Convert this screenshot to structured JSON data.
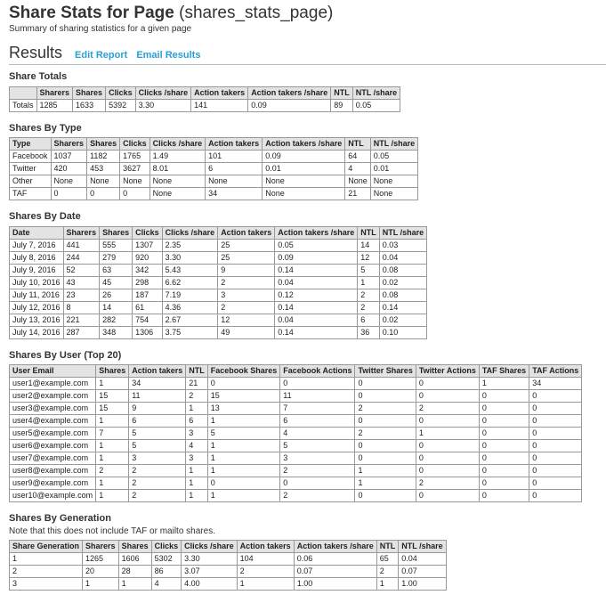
{
  "header": {
    "title": "Share Stats for Page",
    "slug": "(shares_stats_page)",
    "subtitle": "Summary of sharing statistics for a given page"
  },
  "results": {
    "title": "Results",
    "edit_report_label": "Edit Report",
    "email_results_label": "Email Results"
  },
  "tables": [
    {
      "title": "Share Totals",
      "headers": [
        "",
        "Sharers",
        "Shares",
        "Clicks",
        "Clicks /share",
        "Action takers",
        "Action takers /share",
        "NTL",
        "NTL /share"
      ],
      "rows": [
        [
          "Totals",
          "1285",
          "1633",
          "5392",
          "3.30",
          "141",
          "0.09",
          "89",
          "0.05"
        ]
      ]
    },
    {
      "title": "Shares By Type",
      "headers": [
        "Type",
        "Sharers",
        "Shares",
        "Clicks",
        "Clicks /share",
        "Action takers",
        "Action takers /share",
        "NTL",
        "NTL /share"
      ],
      "rows": [
        [
          "Facebook",
          "1037",
          "1182",
          "1765",
          "1.49",
          "101",
          "0.09",
          "64",
          "0.05"
        ],
        [
          "Twitter",
          "420",
          "453",
          "3627",
          "8.01",
          "6",
          "0.01",
          "4",
          "0.01"
        ],
        [
          "Other",
          "None",
          "None",
          "None",
          "None",
          "None",
          "None",
          "None",
          "None"
        ],
        [
          "TAF",
          "0",
          "0",
          "0",
          "None",
          "34",
          "None",
          "21",
          "None"
        ]
      ]
    },
    {
      "title": "Shares By Date",
      "headers": [
        "Date",
        "Sharers",
        "Shares",
        "Clicks",
        "Clicks /share",
        "Action takers",
        "Action takers /share",
        "NTL",
        "NTL /share"
      ],
      "rows": [
        [
          "July 7, 2016",
          "441",
          "555",
          "1307",
          "2.35",
          "25",
          "0.05",
          "14",
          "0.03"
        ],
        [
          "July 8, 2016",
          "244",
          "279",
          "920",
          "3.30",
          "25",
          "0.09",
          "12",
          "0.04"
        ],
        [
          "July 9, 2016",
          "52",
          "63",
          "342",
          "5.43",
          "9",
          "0.14",
          "5",
          "0.08"
        ],
        [
          "July 10, 2016",
          "43",
          "45",
          "298",
          "6.62",
          "2",
          "0.04",
          "1",
          "0.02"
        ],
        [
          "July 11, 2016",
          "23",
          "26",
          "187",
          "7.19",
          "3",
          "0.12",
          "2",
          "0.08"
        ],
        [
          "July 12, 2016",
          "8",
          "14",
          "61",
          "4.36",
          "2",
          "0.14",
          "2",
          "0.14"
        ],
        [
          "July 13, 2016",
          "221",
          "282",
          "754",
          "2.67",
          "12",
          "0.04",
          "6",
          "0.02"
        ],
        [
          "July 14, 2016",
          "287",
          "348",
          "1306",
          "3.75",
          "49",
          "0.14",
          "36",
          "0.10"
        ]
      ]
    },
    {
      "title": "Shares By User (Top 20)",
      "headers": [
        "User Email",
        "Shares",
        "Action takers",
        "NTL",
        "Facebook Shares",
        "Facebook Actions",
        "Twitter Shares",
        "Twitter Actions",
        "TAF Shares",
        "TAF Actions"
      ],
      "rows": [
        [
          "user1@example.com",
          "1",
          "34",
          "21",
          "0",
          "0",
          "0",
          "0",
          "1",
          "34"
        ],
        [
          "user2@example.com",
          "15",
          "11",
          "2",
          "15",
          "11",
          "0",
          "0",
          "0",
          "0"
        ],
        [
          "user3@example.com",
          "15",
          "9",
          "1",
          "13",
          "7",
          "2",
          "2",
          "0",
          "0"
        ],
        [
          "user4@example.com",
          "1",
          "6",
          "6",
          "1",
          "6",
          "0",
          "0",
          "0",
          "0"
        ],
        [
          "user5@example.com",
          "7",
          "5",
          "3",
          "5",
          "4",
          "2",
          "1",
          "0",
          "0"
        ],
        [
          "user6@example.com",
          "1",
          "5",
          "4",
          "1",
          "5",
          "0",
          "0",
          "0",
          "0"
        ],
        [
          "user7@example.com",
          "1",
          "3",
          "3",
          "1",
          "3",
          "0",
          "0",
          "0",
          "0"
        ],
        [
          "user8@example.com",
          "2",
          "2",
          "1",
          "1",
          "2",
          "1",
          "0",
          "0",
          "0"
        ],
        [
          "user9@example.com",
          "1",
          "2",
          "1",
          "0",
          "0",
          "1",
          "2",
          "0",
          "0"
        ],
        [
          "user10@example.com",
          "1",
          "2",
          "1",
          "1",
          "2",
          "0",
          "0",
          "0",
          "0"
        ]
      ]
    },
    {
      "title": "Shares By Generation",
      "note": "Note that this does not include TAF or mailto shares.",
      "headers": [
        "Share Generation",
        "Sharers",
        "Shares",
        "Clicks",
        "Clicks /share",
        "Action takers",
        "Action takers /share",
        "NTL",
        "NTL /share"
      ],
      "rows": [
        [
          "1",
          "1265",
          "1606",
          "5302",
          "3.30",
          "104",
          "0.06",
          "65",
          "0.04"
        ],
        [
          "2",
          "20",
          "28",
          "86",
          "3.07",
          "2",
          "0.07",
          "2",
          "0.07"
        ],
        [
          "3",
          "1",
          "1",
          "4",
          "4.00",
          "1",
          "1.00",
          "1",
          "1.00"
        ]
      ]
    }
  ]
}
